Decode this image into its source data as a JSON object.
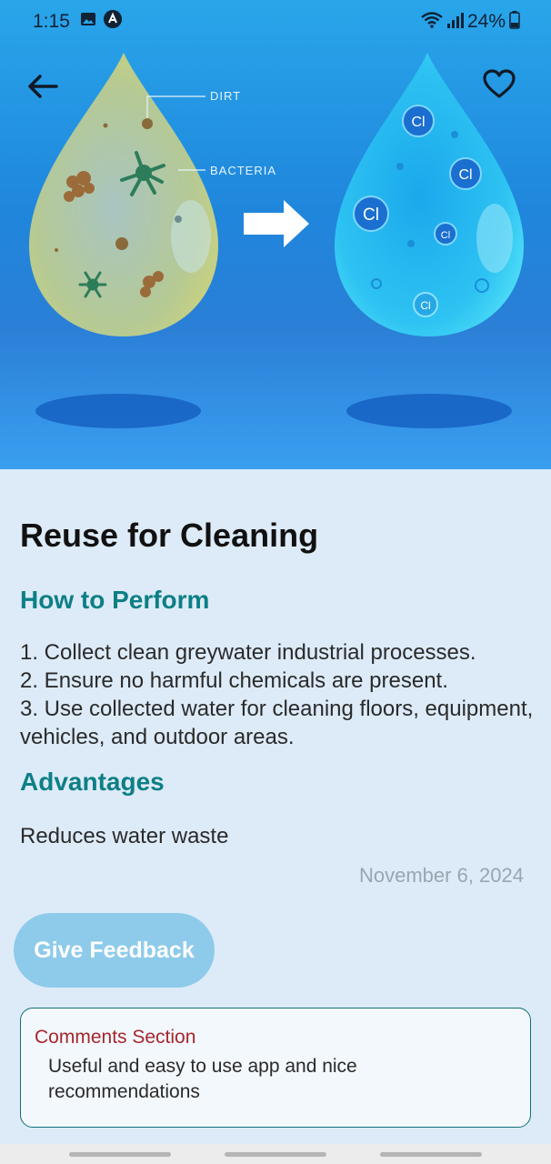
{
  "status_bar": {
    "time": "1:15",
    "battery": "24%",
    "icons": [
      "photo-icon",
      "a-badge-icon",
      "wifi-icon",
      "signal-icon",
      "battery-icon"
    ]
  },
  "hero": {
    "labels": {
      "dirt": "DIRT",
      "bacteria": "BACTERIA"
    },
    "chlorine_symbol": "Cl",
    "colors": {
      "sky_top": "#29a6ea",
      "dirty_drop": "#b9c992",
      "clean_drop": "#2ec3f2"
    }
  },
  "article": {
    "title": "Reuse for Cleaning",
    "how_heading": "How to Perform",
    "steps": [
      "1. Collect clean greywater industrial processes.",
      "2. Ensure no harmful chemicals are present.",
      "3. Use collected water for cleaning floors, equipment, vehicles, and outdoor areas."
    ],
    "advantages_heading": "Advantages",
    "advantage_text": "Reduces water waste",
    "date": "November 6, 2024"
  },
  "feedback": {
    "button_label": "Give Feedback"
  },
  "comments": {
    "title": "Comments Section",
    "text": "Useful and easy to use app and nice recommendations"
  },
  "colors": {
    "accent_teal": "#0d7f86",
    "comments_red": "#a5272c",
    "button_blue": "#8ecbea",
    "background": "#ddebf8"
  }
}
